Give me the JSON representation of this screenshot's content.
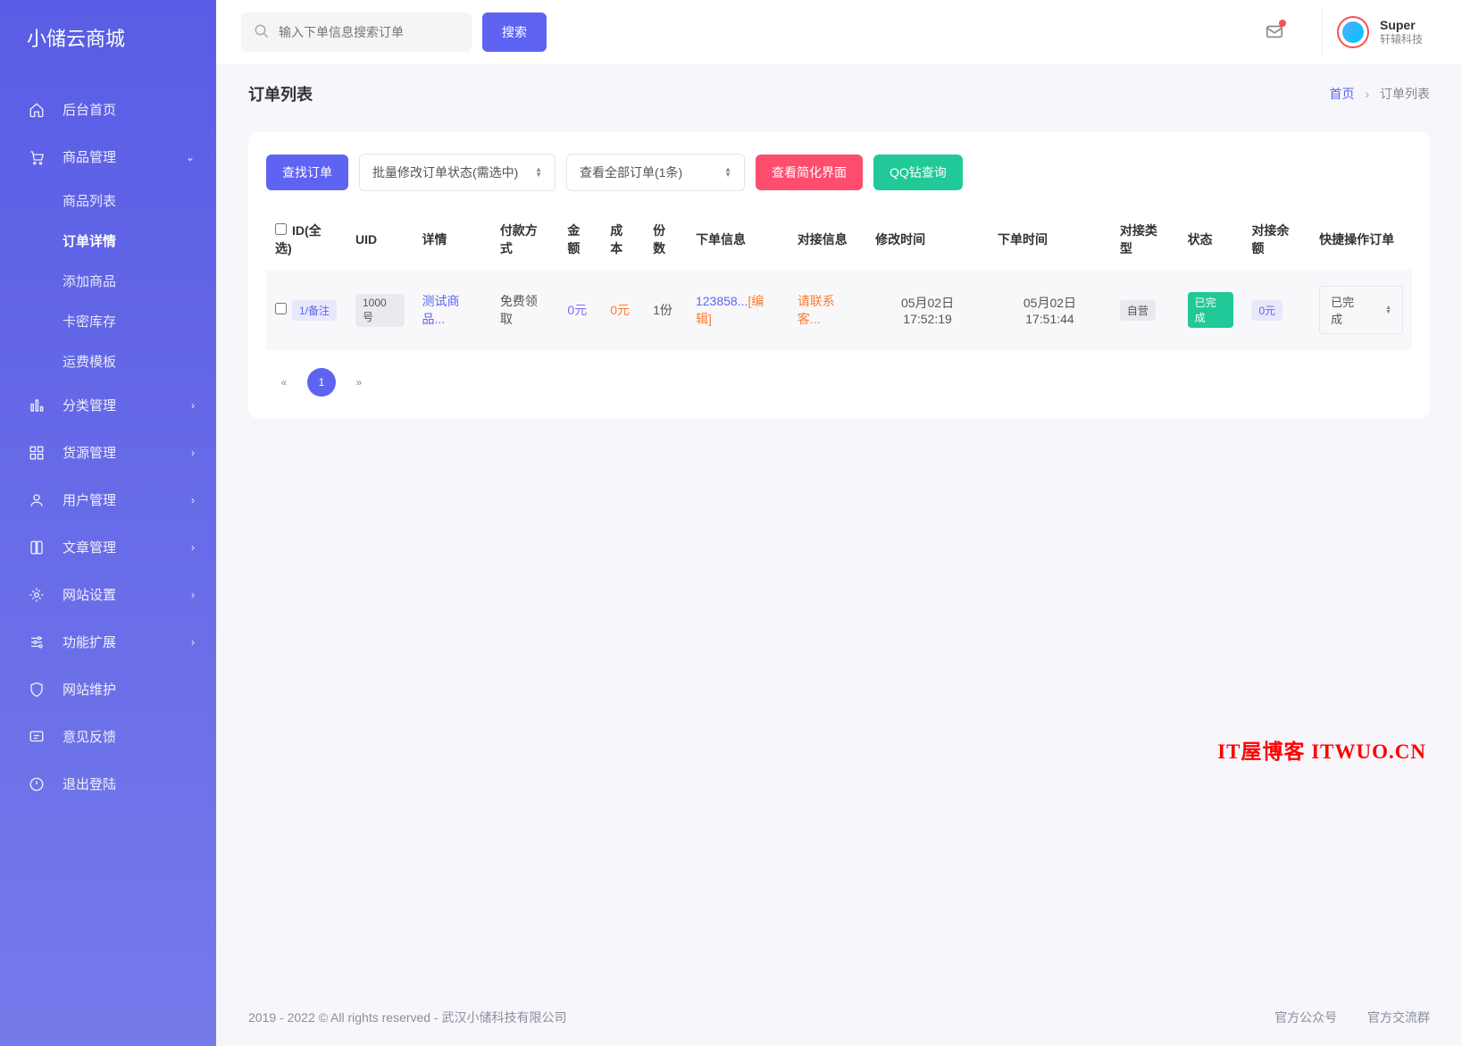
{
  "brand": "小储云商城",
  "sidebar": {
    "home": "后台首页",
    "goods": {
      "label": "商品管理",
      "items": [
        "商品列表",
        "订单详情",
        "添加商品",
        "卡密库存",
        "运费模板"
      ]
    },
    "category": "分类管理",
    "source": "货源管理",
    "user": "用户管理",
    "article": "文章管理",
    "site": "网站设置",
    "ext": "功能扩展",
    "maint": "网站维护",
    "feedback": "意见反馈",
    "logout": "退出登陆"
  },
  "topbar": {
    "search_placeholder": "输入下单信息搜索订单",
    "search_btn": "搜索",
    "user_name": "Super",
    "user_sub": "轩辕科技"
  },
  "page": {
    "title": "订单列表",
    "crumb_home": "首页",
    "crumb_cur": "订单列表"
  },
  "toolbar": {
    "find": "查找订单",
    "batch": "批量修改订单状态(需选中)",
    "filter": "查看全部订单(1条)",
    "simplify": "查看简化界面",
    "qq": "QQ钻查询"
  },
  "columns": [
    "ID(全选)",
    "UID",
    "详情",
    "付款方式",
    "金额",
    "成本",
    "份数",
    "下单信息",
    "对接信息",
    "修改时间",
    "下单时间",
    "对接类型",
    "状态",
    "对接余额",
    "快捷操作订单"
  ],
  "row": {
    "id_badge": "1/备注",
    "uid": "1000号",
    "detail": "测试商品...",
    "pay": "免费领取",
    "amount": "0元",
    "cost": "0元",
    "qty": "1份",
    "order_info": "123858...",
    "order_edit": "[编辑]",
    "dock_info": "请联系客...",
    "mod_time": "05月02日 17:52:19",
    "create_time": "05月02日 17:51:44",
    "dock_type": "自营",
    "status": "已完成",
    "balance": "0元",
    "op": "已完成"
  },
  "pagination": {
    "prev": "«",
    "page": "1",
    "next": "»"
  },
  "watermark": "IT屋博客 ITWUO.CN",
  "footer": {
    "copyright": "2019 - 2022 © All rights reserved - 武汉小储科技有限公司",
    "link_wechat": "官方公众号",
    "link_group": "官方交流群"
  }
}
